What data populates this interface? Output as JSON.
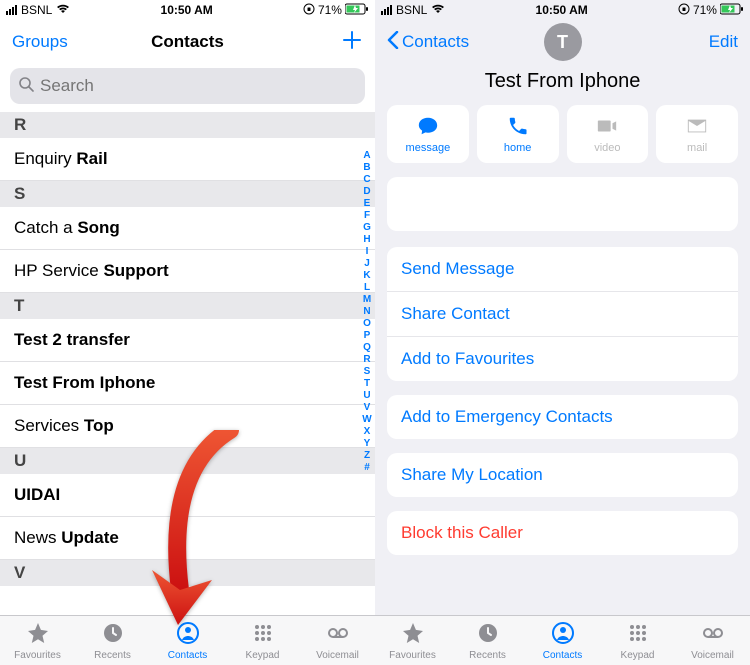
{
  "status": {
    "carrier": "BSNL",
    "time": "10:50 AM",
    "battery": "71%"
  },
  "left": {
    "nav": {
      "back": "Groups",
      "title": "Contacts"
    },
    "search_placeholder": "Search",
    "sections": [
      {
        "letter": "R",
        "items": [
          [
            "Enquiry ",
            "Rail"
          ]
        ]
      },
      {
        "letter": "S",
        "items": [
          [
            "Catch a ",
            "Song"
          ],
          [
            "HP Service ",
            "Support"
          ]
        ]
      },
      {
        "letter": "T",
        "items": [
          [
            "Test 2 transfer",
            ""
          ],
          [
            "Test From Iphone",
            ""
          ],
          [
            "Services ",
            "Top"
          ]
        ]
      },
      {
        "letter": "U",
        "items": [
          [
            "UIDAI",
            ""
          ],
          [
            "News ",
            "Update"
          ]
        ]
      },
      {
        "letter": "V",
        "items": []
      }
    ],
    "index": [
      "A",
      "B",
      "C",
      "D",
      "E",
      "F",
      "G",
      "H",
      "I",
      "J",
      "K",
      "L",
      "M",
      "N",
      "O",
      "P",
      "Q",
      "R",
      "S",
      "T",
      "U",
      "V",
      "W",
      "X",
      "Y",
      "Z",
      "#"
    ]
  },
  "right": {
    "nav": {
      "back": "Contacts",
      "edit": "Edit"
    },
    "avatar_initial": "T",
    "contact_name": "Test From Iphone",
    "quick_actions": [
      {
        "key": "message",
        "label": "message",
        "enabled": true
      },
      {
        "key": "home",
        "label": "home",
        "enabled": true
      },
      {
        "key": "video",
        "label": "video",
        "enabled": false
      },
      {
        "key": "mail",
        "label": "mail",
        "enabled": false
      }
    ],
    "groups": [
      [
        "Send Message",
        "Share Contact",
        "Add to Favourites"
      ],
      [
        "Add to Emergency Contacts"
      ],
      [
        "Share My Location"
      ],
      [
        "Block this Caller"
      ]
    ],
    "destructive_index": [
      3,
      0
    ]
  },
  "tabs": [
    {
      "key": "favourites",
      "label": "Favourites"
    },
    {
      "key": "recents",
      "label": "Recents"
    },
    {
      "key": "contacts",
      "label": "Contacts"
    },
    {
      "key": "keypad",
      "label": "Keypad"
    },
    {
      "key": "voicemail",
      "label": "Voicemail"
    }
  ],
  "active_tab": "contacts"
}
